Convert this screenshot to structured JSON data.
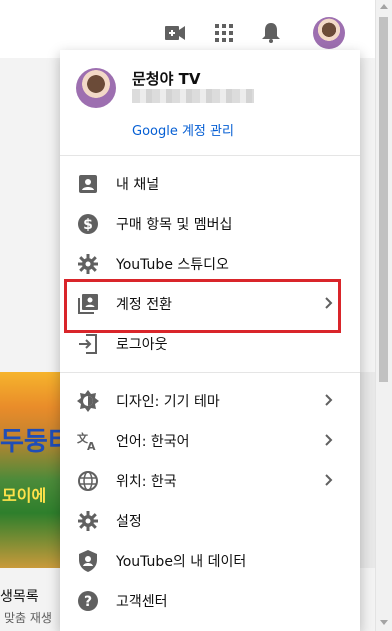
{
  "header": {
    "icons": [
      "video-camera-icon",
      "apps-grid-icon",
      "notifications-bell-icon",
      "account-avatar"
    ]
  },
  "background": {
    "thumbnail_text_top": "두둥티",
    "thumbnail_text_bottom": "모이에",
    "left_label_1": "생목록",
    "left_label_2": "맞춤 재생"
  },
  "account": {
    "name": "문청야 TV",
    "manage_link": "Google 계정 관리"
  },
  "menu": {
    "items": [
      {
        "label": "내 채널",
        "icon": "account-box-icon"
      },
      {
        "label": "구매 항목 및 멤버십",
        "icon": "dollar-circle-icon"
      },
      {
        "label": "YouTube 스튜디오",
        "icon": "gear-icon"
      },
      {
        "label": "계정 전환",
        "icon": "switch-account-icon",
        "has_submenu": true
      },
      {
        "label": "로그아웃",
        "icon": "logout-icon"
      }
    ],
    "settings_items": [
      {
        "label": "디자인: 기기 테마",
        "icon": "theme-icon",
        "has_submenu": true
      },
      {
        "label": "언어: 한국어",
        "icon": "translate-icon",
        "has_submenu": true
      },
      {
        "label": "위치: 한국",
        "icon": "globe-icon",
        "has_submenu": true
      },
      {
        "label": "설정",
        "icon": "gear-icon"
      },
      {
        "label": "YouTube의 내 데이터",
        "icon": "shield-person-icon"
      },
      {
        "label": "고객센터",
        "icon": "help-icon"
      }
    ]
  },
  "colors": {
    "link": "#065fd4",
    "highlight_border": "#d9252a",
    "icon": "#606060"
  }
}
